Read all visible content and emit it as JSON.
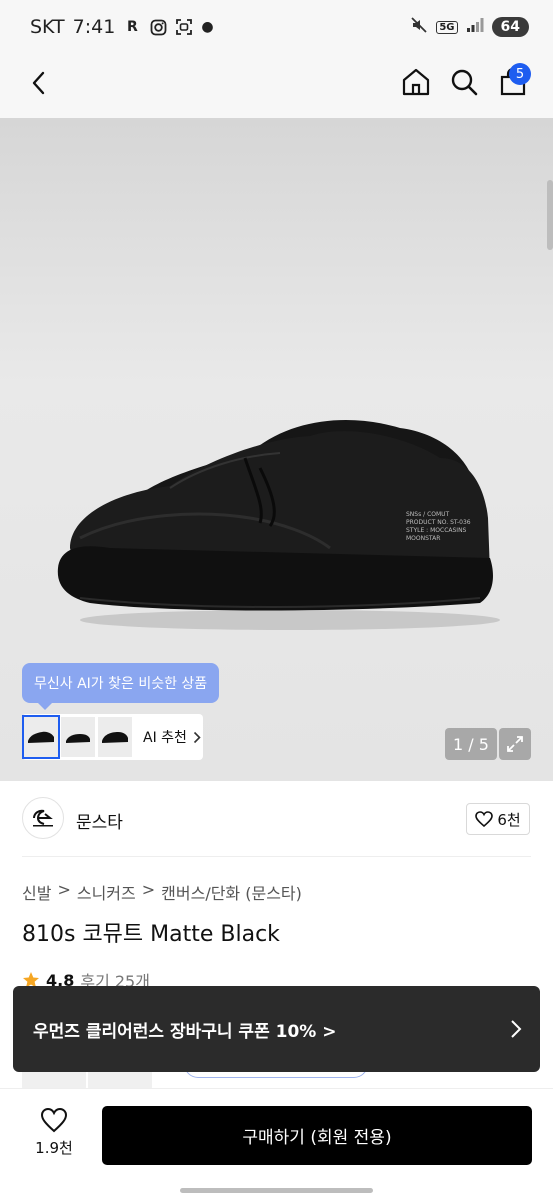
{
  "status_bar": {
    "carrier": "SKT",
    "time": "7:41",
    "network": "5G",
    "battery": "64"
  },
  "header": {
    "cart_count": "5"
  },
  "gallery": {
    "ai_tooltip": "무신사 AI가 찾은 비슷한 상품",
    "ai_recommend_label": "AI 추천",
    "image_counter": "1 / 5",
    "print_text": [
      "SNSs / COMUT",
      "PRODUCT NO. ST-036",
      "STYLE : MOCCASINS",
      "MOONSTAR"
    ]
  },
  "brand": {
    "name": "문스타",
    "likes": "6천"
  },
  "product": {
    "breadcrumb": [
      "신발",
      "스니커즈",
      "캔버스/단화 (문스타)"
    ],
    "name": "810s 코뮤트 Matte Black",
    "rating": "4.8",
    "reviews": "후기 25개"
  },
  "toast": {
    "text": "우먼즈 클리어런스 장바구니 쿠폰 10% >"
  },
  "bottom_bar": {
    "wish_count": "1.9천",
    "buy_label": "구매하기 (회원 전용)"
  },
  "colors": {
    "accent": "#1e5df0",
    "tooltip": "#8aa6f0",
    "toast_bg": "#2b2b2b",
    "buy_bg": "#000000"
  }
}
